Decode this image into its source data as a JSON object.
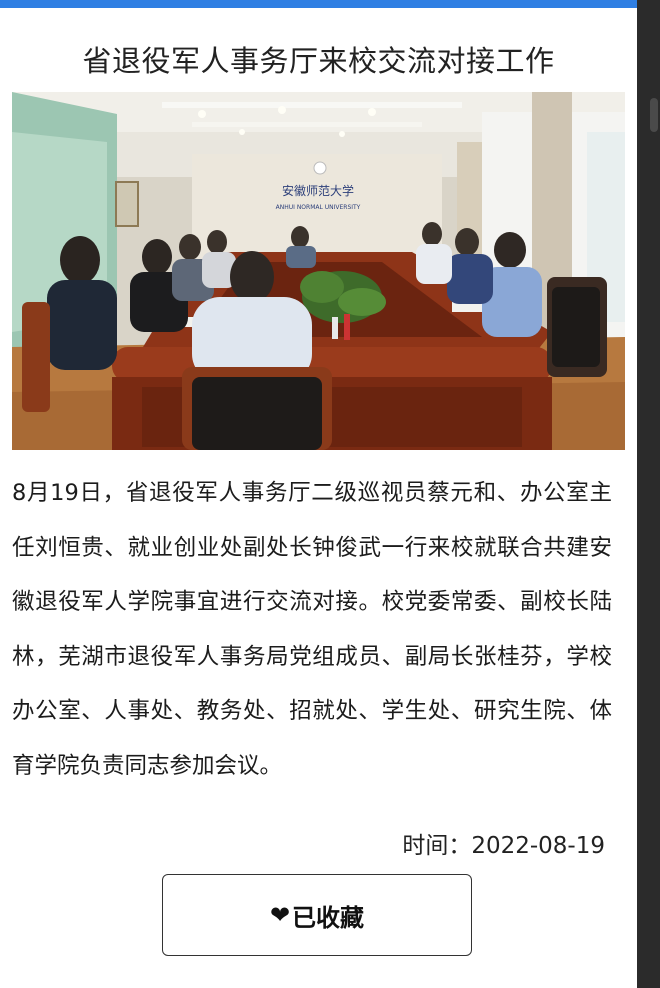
{
  "article": {
    "title": "省退役军人事务厅来校交流对接工作",
    "body": "8月19日，省退役军人事务厅二级巡视员蔡元和、办公室主任刘恒贵、就业创业处副处长钟俊武一行来校就联合共建安徽退役军人学院事宜进行交流对接。校党委常委、副校长陆林，芜湖市退役军人事务局党组成员、副局长张桂芬，学校办公室、人事处、教务处、招就处、学生处、研究生院、体育学院负责同志参加会议。",
    "time_label": "时间：2022-08-19"
  },
  "photo": {
    "wall_text_cn": "安徽师范大学",
    "wall_text_en": "ANHUI NORMAL UNIVERSITY"
  },
  "favorite_button": {
    "icon": "heart-icon",
    "label": "已收藏"
  },
  "colors": {
    "accent": "#2f7fe3"
  }
}
